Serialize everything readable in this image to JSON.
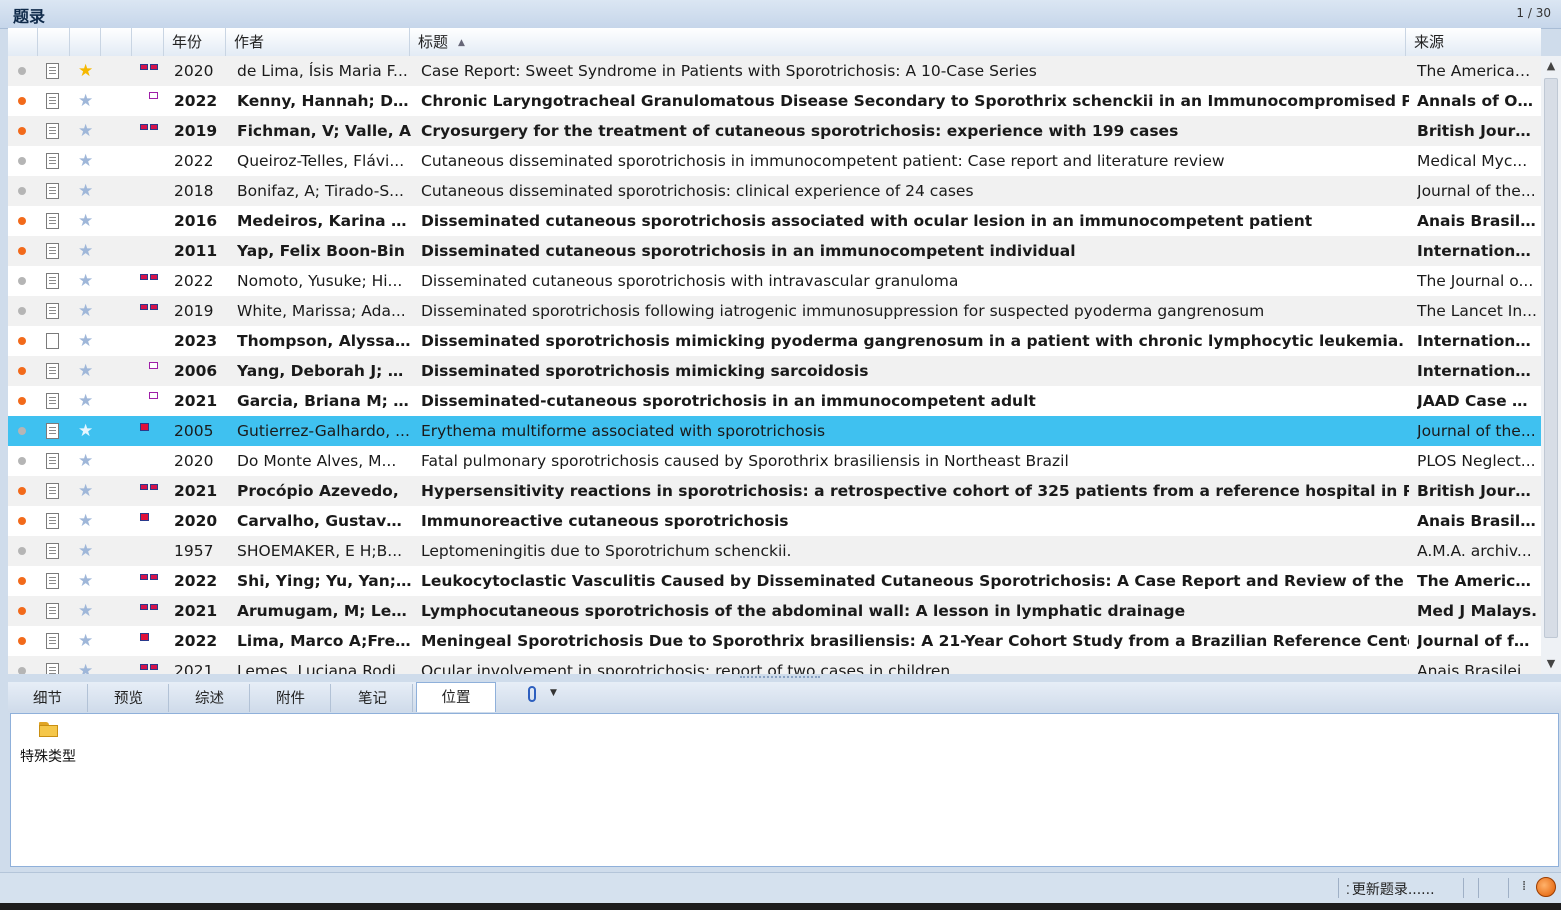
{
  "panel": {
    "title": "题录",
    "pager": "1 / 30"
  },
  "columns": {
    "year": "年份",
    "author": "作者",
    "title": "标题",
    "source": "来源"
  },
  "rows": [
    {
      "year": "2020",
      "author": "de Lima, Ísis Maria F...",
      "title": "Case Report: Sweet Syndrome in Patients with Sporotrichosis: A 10-Case Series",
      "source": "The American...",
      "unread": false,
      "bold": false,
      "starred": true,
      "pdf": "two",
      "file": "doc"
    },
    {
      "year": "2022",
      "author": "Kenny, Hannah; Do..",
      "title": "Chronic Laryngotracheal Granulomatous Disease Secondary to Sporothrix schenckii  in an Immunocompromised Patie",
      "source": "Annals of Oto.",
      "unread": true,
      "bold": true,
      "starred": false,
      "pdf": "mag",
      "file": "doc"
    },
    {
      "year": "2019",
      "author": "Fichman, V; Valle, A",
      "title": "Cryosurgery for the treatment of cutaneous sporotrichosis: experience with 199 cases",
      "source": "British Journal",
      "unread": true,
      "bold": true,
      "starred": false,
      "pdf": "two",
      "file": "doc"
    },
    {
      "year": "2022",
      "author": "Queiroz-Telles, Flávi...",
      "title": "Cutaneous disseminated sporotrichosis in immunocompetent patient: Case report and literature review",
      "source": "Medical Myc...",
      "unread": false,
      "bold": false,
      "starred": false,
      "pdf": "",
      "file": "doc"
    },
    {
      "year": "2018",
      "author": "Bonifaz, A; Tirado-S...",
      "title": "Cutaneous disseminated sporotrichosis: clinical experience of 24 cases",
      "source": "Journal of the...",
      "unread": false,
      "bold": false,
      "starred": false,
      "pdf": "",
      "file": "doc"
    },
    {
      "year": "2016",
      "author": "Medeiros, Karina Bit",
      "title": "Disseminated cutaneous sporotrichosis associated with ocular lesion in an immunocompetent patient",
      "source": "Anais Brasileir",
      "unread": true,
      "bold": true,
      "starred": false,
      "pdf": "",
      "file": "doc"
    },
    {
      "year": "2011",
      "author": "Yap, Felix Boon-Bin",
      "title": "Disseminated cutaneous sporotrichosis in an immunocompetent individual",
      "source": "International ..",
      "unread": true,
      "bold": true,
      "starred": false,
      "pdf": "",
      "file": "doc"
    },
    {
      "year": "2022",
      "author": "Nomoto, Yusuke; Hi...",
      "title": "Disseminated cutaneous sporotrichosis with intravascular granuloma",
      "source": "The Journal o...",
      "unread": false,
      "bold": false,
      "starred": false,
      "pdf": "two",
      "file": "doc"
    },
    {
      "year": "2019",
      "author": "White, Marissa; Ada...",
      "title": "Disseminated sporotrichosis following iatrogenic immunosuppression for suspected pyoderma gangrenosum",
      "source": "The Lancet In...",
      "unread": false,
      "bold": false,
      "starred": false,
      "pdf": "two",
      "file": "doc"
    },
    {
      "year": "2023",
      "author": "Thompson, Alyssa ...",
      "title": "Disseminated sporotrichosis mimicking pyoderma gangrenosum in a patient with chronic lymphocytic leukemia.",
      "source": "International j.",
      "unread": true,
      "bold": true,
      "starred": false,
      "pdf": "",
      "file": "blank"
    },
    {
      "year": "2006",
      "author": "Yang, Deborah J; Kri",
      "title": "Disseminated sporotrichosis mimicking sarcoidosis",
      "source": "International ..",
      "unread": true,
      "bold": true,
      "starred": false,
      "pdf": "mag",
      "file": "doc"
    },
    {
      "year": "2021",
      "author": "Garcia, Briana M; Bc",
      "title": "Disseminated-cutaneous sporotrichosis in an immunocompetent adult",
      "source": "JAAD Case Re.",
      "unread": true,
      "bold": true,
      "starred": false,
      "pdf": "mag",
      "file": "doc"
    },
    {
      "year": "2005",
      "author": "Gutierrez-Galhardo, ...",
      "title": "Erythema multiforme associated with sporotrichosis",
      "source": "Journal of the...",
      "unread": false,
      "bold": false,
      "starred": false,
      "pdf": "red",
      "file": "doc",
      "selected": true
    },
    {
      "year": "2020",
      "author": "Do Monte Alves, M...",
      "title": "Fatal pulmonary sporotrichosis caused by Sporothrix brasiliensis in Northeast Brazil",
      "source": "PLOS Neglect...",
      "unread": false,
      "bold": false,
      "starred": false,
      "pdf": "",
      "file": "doc"
    },
    {
      "year": "2021",
      "author": "Procópio Azevedo,",
      "title": "Hypersensitivity reactions in sporotrichosis: a retrospective cohort of 325 patients from a reference hospital in Rio de",
      "source": "British Journal",
      "unread": true,
      "bold": true,
      "starred": false,
      "pdf": "two",
      "file": "doc"
    },
    {
      "year": "2020",
      "author": "Carvalho, Gustavo ..",
      "title": "Immunoreactive cutaneous sporotrichosis",
      "source": "Anais Brasileir",
      "unread": true,
      "bold": true,
      "starred": false,
      "pdf": "red",
      "file": "doc"
    },
    {
      "year": "1957",
      "author": "SHOEMAKER, E H;B...",
      "title": "Leptomeningitis due to Sporotrichum schenckii.",
      "source": "A.M.A. archiv...",
      "unread": false,
      "bold": false,
      "starred": false,
      "pdf": "",
      "file": "doc"
    },
    {
      "year": "2022",
      "author": "Shi, Ying; Yu, Yan; Li.",
      "title": "Leukocytoclastic Vasculitis Caused by Disseminated Cutaneous Sporotrichosis: A Case Report and Review of the Literat",
      "source": "The American.",
      "unread": true,
      "bold": true,
      "starred": false,
      "pdf": "two",
      "file": "doc"
    },
    {
      "year": "2021",
      "author": "Arumugam, M; Leel.",
      "title": "Lymphocutaneous sporotrichosis of the abdominal wall: A lesson in lymphatic drainage",
      "source": "Med J Malays.",
      "unread": true,
      "bold": true,
      "starred": false,
      "pdf": "two",
      "file": "doc"
    },
    {
      "year": "2022",
      "author": "Lima, Marco A;Freit.",
      "title": "Meningeal Sporotrichosis Due to Sporothrix brasiliensis: A 21-Year Cohort Study from a Brazilian Reference Center.",
      "source": "Journal of fun.",
      "unread": true,
      "bold": true,
      "starred": false,
      "pdf": "red",
      "file": "doc"
    },
    {
      "year": "2021",
      "author": "Lemes, Luciana Rodi...",
      "title": "Ocular involvement in sporotrichosis: report of two cases in children",
      "source": "Anais Brasileir...",
      "unread": false,
      "bold": false,
      "starred": false,
      "pdf": "two",
      "file": "doc"
    }
  ],
  "tabs": [
    {
      "label": "细节",
      "active": false
    },
    {
      "label": "预览",
      "active": false
    },
    {
      "label": "综述",
      "active": false
    },
    {
      "label": "附件",
      "active": false
    },
    {
      "label": "笔记",
      "active": false
    },
    {
      "label": "位置",
      "active": true
    }
  ],
  "location": {
    "folder_label": "特殊类型"
  },
  "status": {
    "update": "更新题录......"
  },
  "colors": {
    "selected_row": "#3fc1f0",
    "unread_dot": "#f26a1b",
    "read_dot": "#b5b5b5",
    "star": "#f5b800"
  }
}
